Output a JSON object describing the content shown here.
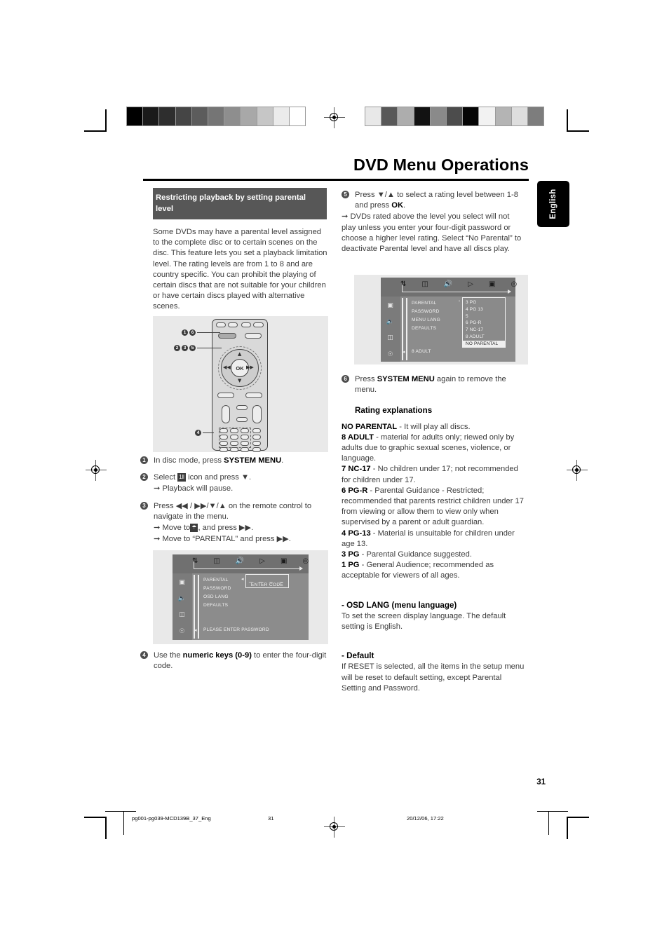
{
  "document": {
    "title": "DVD Menu Operations",
    "language_tab": "English",
    "page_number": "31",
    "footer": {
      "file": "pg001-pg039-MCD139B_37_Eng",
      "page": "31",
      "timestamp": "20/12/06, 17:22"
    }
  },
  "left_column": {
    "section_heading": "Restricting playback by setting parental level",
    "intro": "Some DVDs may have a parental level assigned to the complete disc or to certain scenes on the disc. This feature lets you set a playback limitation level. The rating levels are from 1 to 8 and are country specific. You can prohibit the playing of certain discs that are not suitable for your children or have certain discs played with alternative scenes.",
    "steps": [
      {
        "num": "1",
        "text_pre": "In disc mode, press ",
        "bold": "SYSTEM MENU",
        "text_post": ".",
        "subs": []
      },
      {
        "num": "2",
        "text_pre": "Select ",
        "icon": "tools-icon",
        "text_post": " icon and press ▼.",
        "subs": [
          "Playback will pause."
        ]
      },
      {
        "num": "3",
        "text_pre": "Press ◀◀ / ▶▶/▼/▲  on the remote control to navigate in the menu.",
        "subs": [
          "Move to  , and press ▶▶.",
          "Move to “PARENTAL” and press ▶▶."
        ]
      },
      {
        "num": "4",
        "text_pre": "Use the ",
        "bold": "numeric keys (0-9)",
        "text_post": " to enter the four-digit code.",
        "subs": []
      }
    ]
  },
  "right_column": {
    "steps": [
      {
        "num": "5",
        "text_pre": "Press ▼/▲  to select a rating level between 1-8 and press ",
        "bold": "OK",
        "text_post": ".",
        "subs": [
          "DVDs rated above the level you select will not play unless you enter your four-digit password or choose a higher level rating. Select “No Parental” to deactivate Parental level and have all discs play."
        ]
      },
      {
        "num": "6",
        "text_pre": "Press ",
        "bold": "SYSTEM MENU",
        "text_post": " again to remove the menu.",
        "subs": []
      }
    ],
    "rating_heading": "Rating explanations",
    "ratings": [
      {
        "label": "NO PARENTAL",
        "desc": "  - It will play all discs."
      },
      {
        "label": "8 ADULT",
        "desc": " - material for adults only; riewed only by adults due to graphic sexual scenes, violence, or language."
      },
      {
        "label": "7 NC-17",
        "desc": " - No children under 17; not recommended for children under 17."
      },
      {
        "label": "6 PG-R",
        "desc": " - Parental Guidance - Restricted; recommended that parents restrict children under 17 from viewing or allow them to view only when supervised by a parent or adult guardian."
      },
      {
        "label": "4 PG-13",
        "desc": " - Material  is unsuitable for children under age 13."
      },
      {
        "label": "3 PG",
        "desc": " - Parental Guidance suggested."
      },
      {
        "label": "1 PG",
        "desc": " - General Audience; recommended as acceptable for viewers of all ages."
      }
    ],
    "osd_lang_heading": "- OSD LANG (menu language)",
    "osd_lang_body": "To set the screen display language. The default setting is English.",
    "default_heading": "- Default",
    "default_body": "If RESET is selected, all the items in the setup menu will be reset to default setting,  except Parental Setting and Password."
  },
  "osd_password": {
    "icon_bar": [
      "tools-icon",
      "display-icon",
      "audio-icon",
      "playback-icon",
      "video-icon",
      "preference-icon"
    ],
    "rail_icons": [
      "tv-icon",
      "speaker-icon",
      "subtitle-icon",
      "lock-icon"
    ],
    "menu_items": [
      "PARENTAL",
      "PASSWORD",
      "OSD LANG",
      "DEFAULTS"
    ],
    "box_label_dashes": "_  _  _  _",
    "box_label": "ENTER CODE",
    "status": "PLEASE ENTER PASSWORD"
  },
  "osd_parental": {
    "icon_bar": [
      "tools-icon",
      "display-icon",
      "audio-icon",
      "playback-icon",
      "video-icon",
      "preference-icon"
    ],
    "rail_icons": [
      "tv-icon",
      "speaker-icon",
      "subtitle-icon",
      "lock-icon"
    ],
    "menu_items": [
      "PARENTAL",
      "PASSWORD",
      "MENU LANG",
      "DEFAULTS"
    ],
    "rating_options": [
      "3 PG",
      "4 PG 13",
      "5",
      "6 PG-R",
      "7 NC-17",
      "8 ADULT",
      "NO PARENTAL"
    ],
    "selected_option": "NO PARENTAL",
    "status": "8 ADULT"
  },
  "remote": {
    "callouts": [
      {
        "id": "c1",
        "labels": [
          "1",
          "6"
        ]
      },
      {
        "id": "c2",
        "labels": [
          "2",
          "3",
          "5"
        ]
      },
      {
        "id": "c3",
        "labels": [
          "4"
        ]
      }
    ],
    "ok_label": "OK"
  },
  "calibration": {
    "left_bar": [
      "#000000",
      "#1a1a1a",
      "#2e2e2e",
      "#454545",
      "#5c5c5c",
      "#757575",
      "#8e8e8e",
      "#a8a8a8",
      "#c6c6c6",
      "#ebebeb",
      "#ffffff"
    ],
    "right_bar": [
      "#e8e8e8",
      "#585858",
      "#adadad",
      "#121212",
      "#8a8a8a",
      "#4c4c4c",
      "#050505",
      "#f2f2f2",
      "#b4b4b4",
      "#dedede",
      "#7d7d7d"
    ]
  }
}
